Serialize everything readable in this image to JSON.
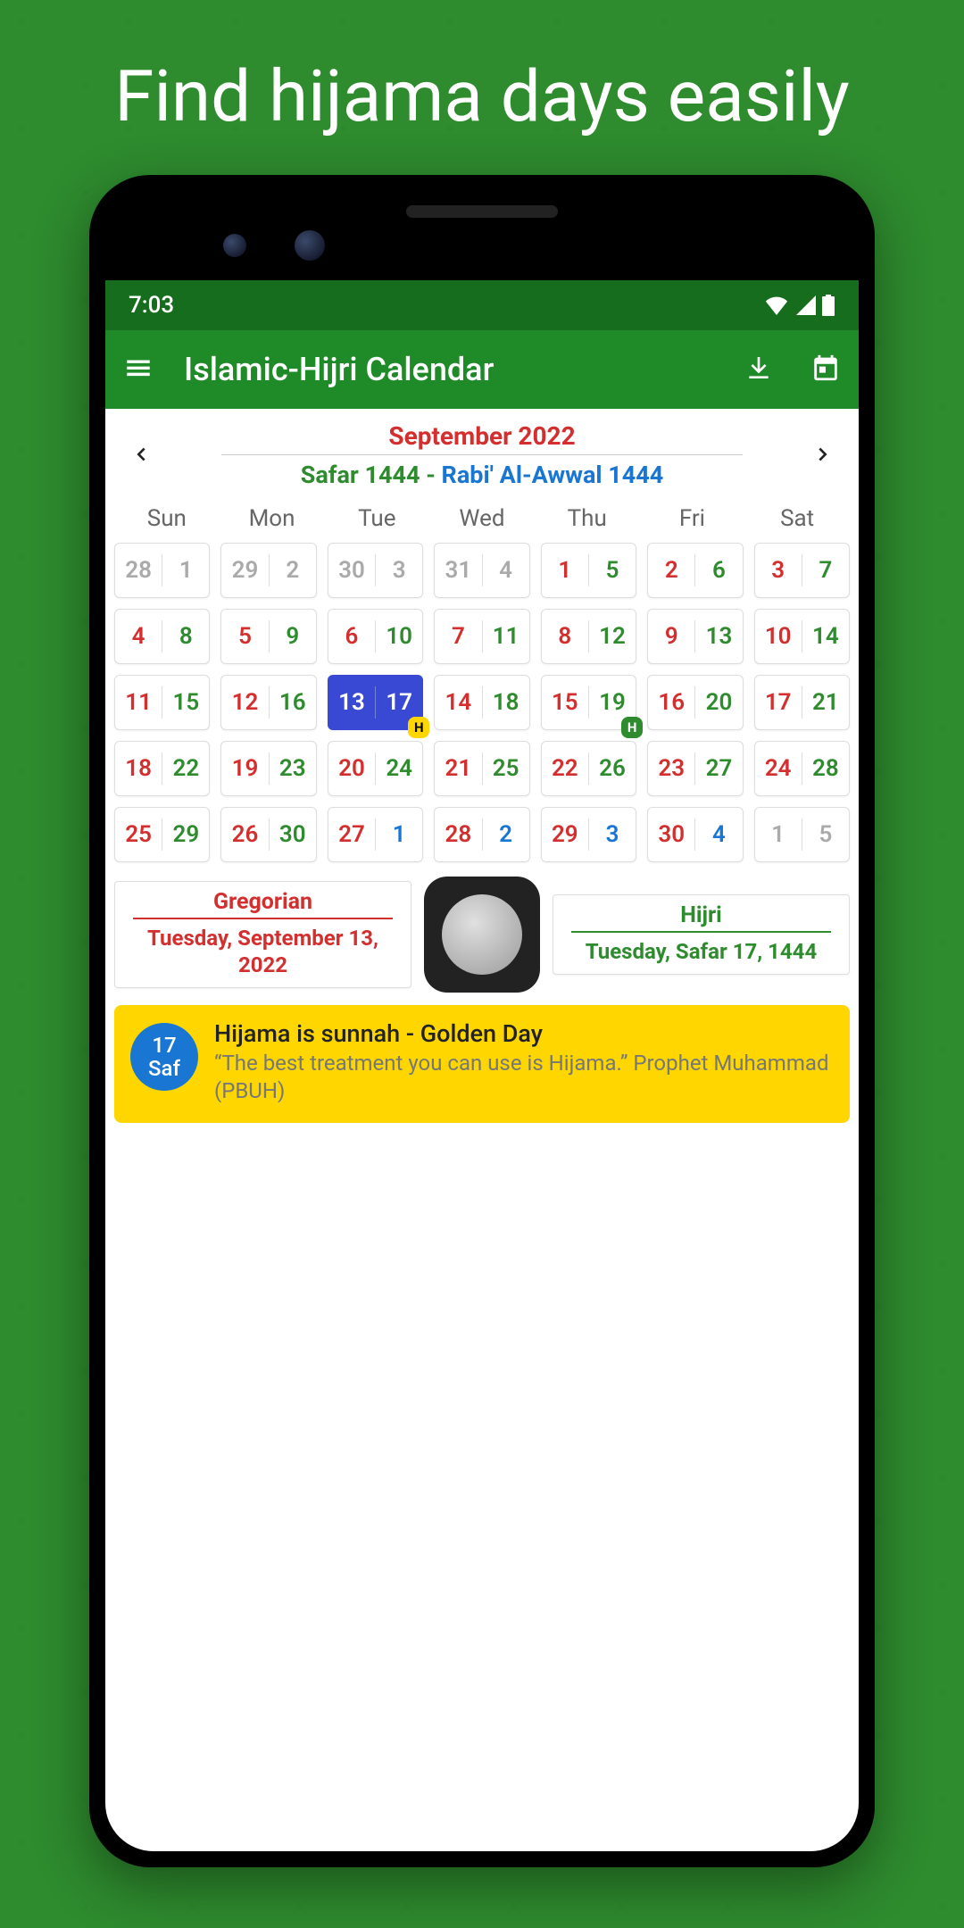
{
  "headline": "Find hijama days easily",
  "status": {
    "time": "7:03"
  },
  "appbar": {
    "title": "Islamic-Hijri Calendar"
  },
  "month": {
    "gregorian": "September 2022",
    "hijri1": "Safar 1444",
    "sep": " - ",
    "hijri2": "Rabi' Al-Awwal 1444"
  },
  "weekdays": [
    "Sun",
    "Mon",
    "Tue",
    "Wed",
    "Thu",
    "Fri",
    "Sat"
  ],
  "cells": [
    {
      "g": "28",
      "h": "1",
      "muted": true
    },
    {
      "g": "29",
      "h": "2",
      "muted": true
    },
    {
      "g": "30",
      "h": "3",
      "muted": true
    },
    {
      "g": "31",
      "h": "4",
      "muted": true
    },
    {
      "g": "1",
      "h": "5"
    },
    {
      "g": "2",
      "h": "6"
    },
    {
      "g": "3",
      "h": "7"
    },
    {
      "g": "4",
      "h": "8"
    },
    {
      "g": "5",
      "h": "9"
    },
    {
      "g": "6",
      "h": "10"
    },
    {
      "g": "7",
      "h": "11"
    },
    {
      "g": "8",
      "h": "12"
    },
    {
      "g": "9",
      "h": "13"
    },
    {
      "g": "10",
      "h": "14"
    },
    {
      "g": "11",
      "h": "15"
    },
    {
      "g": "12",
      "h": "16"
    },
    {
      "g": "13",
      "h": "17",
      "selected": true,
      "badge": "yellow"
    },
    {
      "g": "14",
      "h": "18"
    },
    {
      "g": "15",
      "h": "19",
      "badge": "green"
    },
    {
      "g": "16",
      "h": "20"
    },
    {
      "g": "17",
      "h": "21"
    },
    {
      "g": "18",
      "h": "22"
    },
    {
      "g": "19",
      "h": "23"
    },
    {
      "g": "20",
      "h": "24"
    },
    {
      "g": "21",
      "h": "25"
    },
    {
      "g": "22",
      "h": "26"
    },
    {
      "g": "23",
      "h": "27"
    },
    {
      "g": "24",
      "h": "28"
    },
    {
      "g": "25",
      "h": "29"
    },
    {
      "g": "26",
      "h": "30"
    },
    {
      "g": "27",
      "h": "1",
      "hblue": true
    },
    {
      "g": "28",
      "h": "2",
      "hblue": true
    },
    {
      "g": "29",
      "h": "3",
      "hblue": true
    },
    {
      "g": "30",
      "h": "4",
      "hblue": true
    },
    {
      "g": "1",
      "h": "5",
      "muted": true
    }
  ],
  "dateinfo": {
    "greg_label": "Gregorian",
    "greg_value": "Tuesday, September 13, 2022",
    "hij_label": "Hijri",
    "hij_value": "Tuesday, Safar 17, 1444"
  },
  "banner": {
    "day": "17",
    "month": "Saf",
    "title": "Hijama is sunnah - Golden Day",
    "quote": "“The best treatment you can use is Hijama.” Prophet Muhammad (PBUH)"
  }
}
